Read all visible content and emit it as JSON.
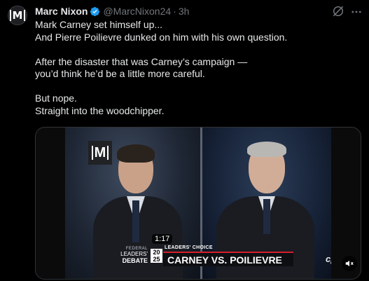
{
  "author": {
    "name": "Marc Nixon",
    "handle": "@MarcNixon24",
    "separator": "·",
    "time": "3h",
    "avatar_letter": "M",
    "verified": true,
    "verified_color": "#1d9bf0"
  },
  "tweet": {
    "paragraphs": [
      "Mark Carney set himself up...\nAnd Pierre Poilievre dunked on him with his own question.",
      "After the disaster that was Carney’s campaign —\nyou’d think he’d be a little more careful.",
      "But nope.\nStraight into the woodchipper."
    ]
  },
  "media": {
    "watermark": "M",
    "duration": "1:17",
    "lower_third": {
      "logo_line1": "FEDERAL",
      "logo_line2": "LEADERS'",
      "logo_line3": "DEBATE",
      "year": "20 25",
      "kicker": "LEADERS' CHOICE",
      "headline": "CARNEY VS. POILIEVRE",
      "network": "cpac",
      "accent_color": "#d21f2b"
    }
  },
  "icons": {
    "grok": "grok-icon",
    "more": "more-icon",
    "mute": "speaker-muted-icon"
  }
}
